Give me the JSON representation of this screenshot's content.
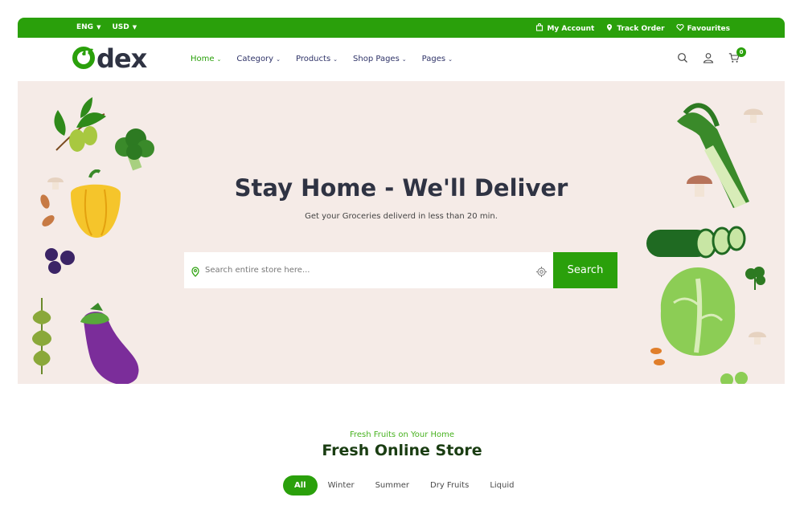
{
  "topbar": {
    "language": "ENG",
    "currency": "USD",
    "my_account": "My Account",
    "track_order": "Track Order",
    "favourites": "Favourites",
    "bg_color": "#2aa00b"
  },
  "header": {
    "logo_text": "dex",
    "nav": [
      {
        "label": "Home",
        "active": true
      },
      {
        "label": "Category",
        "active": false
      },
      {
        "label": "Products",
        "active": false
      },
      {
        "label": "Shop Pages",
        "active": false
      },
      {
        "label": "Pages",
        "active": false
      }
    ],
    "cart_count": "0",
    "icons": [
      "search-icon",
      "user-icon",
      "cart-icon"
    ]
  },
  "hero": {
    "title": "Stay Home - We'll Deliver",
    "subtitle": "Get your Groceries deliverd in less than 20 min.",
    "search_placeholder": "Search entire store here...",
    "search_button": "Search",
    "bg_color": "#f5ebe7"
  },
  "store": {
    "kicker": "Fresh Fruits on Your Home",
    "title": "Fresh Online Store",
    "filters": [
      {
        "label": "All",
        "active": true
      },
      {
        "label": "Winter",
        "active": false
      },
      {
        "label": "Summer",
        "active": false
      },
      {
        "label": "Dry Fruits",
        "active": false
      },
      {
        "label": "Liquid",
        "active": false
      }
    ]
  }
}
